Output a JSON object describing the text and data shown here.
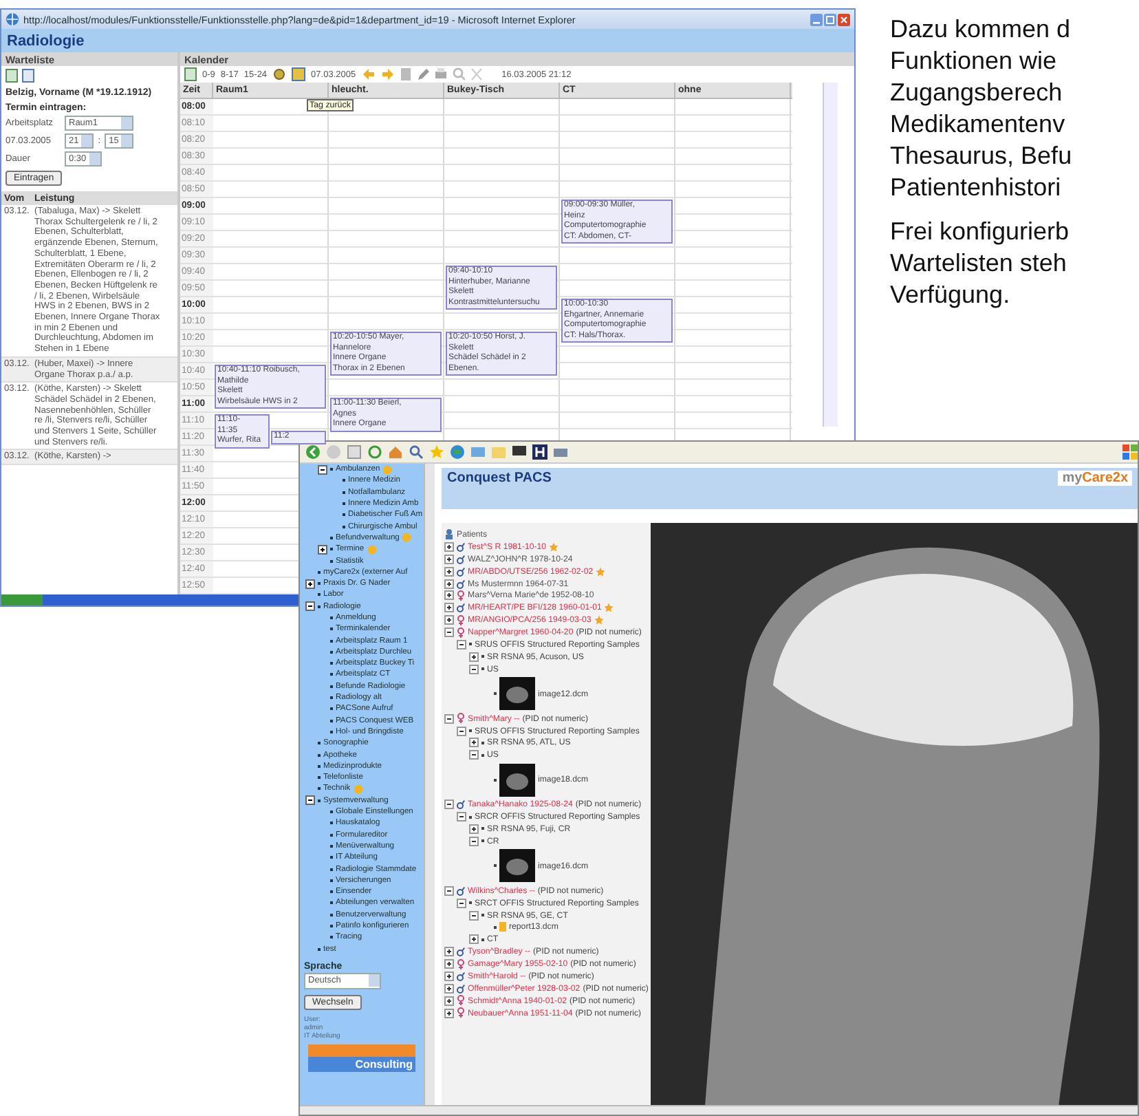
{
  "ie_window": {
    "title": "http://localhost/modules/Funktionsstelle/Funktionsstelle.php?lang=de&pid=1&department_id=19 - Microsoft Internet Explorer",
    "page_title": "Radiologie",
    "waitlist": {
      "title": "Warteliste",
      "patient": "Belzig, Vorname (M *19.12.1912)",
      "form_title": "Termin eintragen:",
      "workplace_label": "Arbeitsplatz",
      "workplace": "Raum1",
      "date": "07.03.2005",
      "hour": "21",
      "separator": ":",
      "minute": "15",
      "duration_label": "Dauer",
      "duration": "0:30",
      "submit": "Eintragen",
      "columns": [
        "Vom",
        "Leistung"
      ],
      "rows": [
        {
          "date": "03.12.",
          "text": "(Tabaluga, Max) -> Skelett Thorax Schultergelenk re / li, 2 Ebenen, Schulterblatt, ergänzende Ebenen, Sternum, Schulterblatt, 1 Ebene, Extremitäten Oberarm re / li, 2 Ebenen, Ellenbogen re / li, 2 Ebenen, Becken Hüftgelenk re / li, 2 Ebenen, Wirbelsäule HWS in 2 Ebenen, BWS in 2 Ebenen, Innere Organe Thorax in min 2 Ebenen und Durchleuchtung, Abdomen im Stehen in 1 Ebene"
        },
        {
          "date": "03.12.",
          "text": "(Huber, Maxei) -> Innere Organe Thorax p.a./ a.p."
        },
        {
          "date": "03.12.",
          "text": "(Köthe, Karsten) -> Skelett Schädel Schädel in 2 Ebenen, Nasennebenhöhlen, Schüller re /li, Stenvers re/li, Schüller und Stenvers 1 Seite, Schüller und Stenvers re/li."
        },
        {
          "date": "03.12.",
          "text": "(Köthe, Karsten) ->"
        }
      ]
    },
    "calendar": {
      "title": "Kalender",
      "ranges": [
        "0-9",
        "8-17",
        "15-24"
      ],
      "date": "07.03.2005",
      "now": "16.03.2005 21:12",
      "tooltip": "Tag zurück",
      "columns": [
        "Zeit",
        "Raum1",
        "hleucht.",
        "Bukey-Tisch",
        "CT",
        "ohne"
      ],
      "times": [
        {
          "label": "08:00",
          "full_hour": true
        },
        {
          "label": "08:10",
          "full_hour": false
        },
        {
          "label": "08:20",
          "full_hour": false
        },
        {
          "label": "08:30",
          "full_hour": false
        },
        {
          "label": "08:40",
          "full_hour": false
        },
        {
          "label": "08:50",
          "full_hour": false
        },
        {
          "label": "09:00",
          "full_hour": true,
          "cells": [
            null,
            null,
            null,
            {
              "kind": "full",
              "lines": [
                "09:00-09:30 Müller,",
                "Heinz",
                "Computertomographie",
                "CT: Abdomen, CT-"
              ]
            },
            null
          ]
        },
        {
          "label": "09:10",
          "full_hour": false
        },
        {
          "label": "09:20",
          "full_hour": false
        },
        {
          "label": "09:30",
          "full_hour": false
        },
        {
          "label": "09:40",
          "full_hour": false,
          "cells": [
            null,
            null,
            {
              "kind": "full",
              "lines": [
                "09:40-10:10",
                "Hinterhuber, Marianne",
                "Skelett",
                "Kontrastmitteluntersuchu"
              ]
            },
            null,
            null
          ]
        },
        {
          "label": "09:50",
          "full_hour": false
        },
        {
          "label": "10:00",
          "full_hour": true,
          "cells": [
            null,
            null,
            null,
            {
              "kind": "full",
              "lines": [
                "10:00-10:30",
                "Ehgartner, Annemarie",
                "Computertomographie",
                "CT: Hals/Thorax."
              ]
            },
            null
          ]
        },
        {
          "label": "10:10",
          "full_hour": false
        },
        {
          "label": "10:20",
          "full_hour": false,
          "cells": [
            null,
            {
              "kind": "full",
              "lines": [
                "10:20-10:50 Mayer,",
                "Hannelore",
                "Innere Organe",
                "Thorax in 2 Ebenen"
              ]
            },
            {
              "kind": "full",
              "lines": [
                "10:20-10:50 Horst, J.",
                "Skelett",
                "Schädel Schädel in 2",
                "Ebenen."
              ]
            },
            null,
            null
          ]
        },
        {
          "label": "10:30",
          "full_hour": false
        },
        {
          "label": "10:40",
          "full_hour": false,
          "cells": [
            {
              "kind": "full",
              "lines": [
                "10:40-11:10 Roibusch,",
                "Mathilde",
                "Skelett",
                "Wirbelsäule HWS in 2"
              ]
            },
            null,
            null,
            null,
            null
          ]
        },
        {
          "label": "10:50",
          "full_hour": false
        },
        {
          "label": "11:00",
          "full_hour": true,
          "cells": [
            null,
            {
              "kind": "full",
              "lines": [
                "11:00-11:30 Beierl,",
                "Agnes",
                "Innere Organe"
              ]
            },
            null,
            null,
            null
          ]
        },
        {
          "label": "11:10",
          "full_hour": false,
          "cells": [
            {
              "kind": "left",
              "lines": [
                "11:10-",
                "11:35",
                "Wurfer, Rita"
              ]
            },
            null,
            null,
            null,
            null
          ]
        },
        {
          "label": "11:20",
          "full_hour": false,
          "cells": [
            {
              "kind": "right",
              "lines": [
                "11:2"
              ]
            },
            null,
            null,
            null,
            null
          ]
        },
        {
          "label": "11:30",
          "full_hour": false
        },
        {
          "label": "11:40",
          "full_hour": false
        },
        {
          "label": "11:50",
          "full_hour": false
        },
        {
          "label": "12:00",
          "full_hour": true
        },
        {
          "label": "12:10",
          "full_hour": false
        },
        {
          "label": "12:20",
          "full_hour": false
        },
        {
          "label": "12:30",
          "full_hour": false
        },
        {
          "label": "12:40",
          "full_hour": false
        },
        {
          "label": "12:50",
          "full_hour": false
        }
      ]
    }
  },
  "slide_text": {
    "paragraphs": [
      [
        "Dazu kommen d",
        "Funktionen wie",
        "Zugangsberech",
        "Medikamentenv",
        "Thesaurus, Befu",
        "Patientenhistori"
      ],
      [
        "Frei konfigurierb",
        "Wartelisten steh",
        "Verfügung."
      ]
    ]
  },
  "pacs_window": {
    "header": "Conquest PACS",
    "logo": {
      "prefix": "my",
      "brand": "Care2x"
    },
    "menu": {
      "continued": [
        {
          "label": "Ambulanzen",
          "badge": true,
          "expanded": true,
          "children": [
            {
              "label": "Innere Medizin"
            },
            {
              "label": "Notfallambulanz"
            },
            {
              "label": "Innere Medizin Amb"
            },
            {
              "label": "Diabetischer Fuß Am"
            },
            {
              "label": "Chirurgische Ambul"
            }
          ]
        },
        {
          "label": "Befundverwaltung",
          "badge": true
        },
        {
          "label": "Termine",
          "badge": true,
          "expanded": false
        },
        {
          "label": "Statistik"
        }
      ],
      "items": [
        {
          "label": "myCare2x (externer Auf"
        },
        {
          "label": "Praxis Dr. G Nader",
          "expanded": false
        },
        {
          "label": "Labor"
        },
        {
          "label": "Radiologie",
          "expanded": true,
          "children": [
            {
              "label": "Anmeldung"
            },
            {
              "label": "Terminkalender"
            },
            {
              "label": "Arbeitsplatz Raum 1"
            },
            {
              "label": "Arbeitsplatz Durchleu"
            },
            {
              "label": "Arbeitsplatz Buckey Ti"
            },
            {
              "label": "Arbeitsplatz CT"
            },
            {
              "label": "Befunde Radiologie"
            },
            {
              "label": "Radiology alt"
            },
            {
              "label": "PACSone Aufruf"
            },
            {
              "label": "PACS Conquest WEB"
            },
            {
              "label": "Hol- und Bringdiste"
            }
          ]
        },
        {
          "label": "Sonographie"
        },
        {
          "label": "Apotheke"
        },
        {
          "label": "Medizinprodukte"
        },
        {
          "label": "Telefonliste"
        },
        {
          "label": "Technik",
          "badge": true
        },
        {
          "label": "Systemverwaltung",
          "expanded": true,
          "children": [
            {
              "label": "Globale Einstellungen"
            },
            {
              "label": "Hauskatalog"
            },
            {
              "label": "Formulareditor"
            },
            {
              "label": "Menüverwaltung"
            },
            {
              "label": "IT Abteilung"
            },
            {
              "label": "Radiologie Stammdate"
            },
            {
              "label": "Versicherungen"
            },
            {
              "label": "Einsender"
            },
            {
              "label": "Abteilungen verwalten"
            },
            {
              "label": "Benutzerverwaltung"
            },
            {
              "label": "Patinfo konfigurieren"
            },
            {
              "label": "Tracing"
            }
          ]
        },
        {
          "label": "test"
        }
      ]
    },
    "language_label": "Sprache",
    "language": "Deutsch",
    "switch_button": "Wechseln",
    "user_info": [
      "User:",
      "admin",
      "IT Abteilung"
    ],
    "company_logo": "Consulting",
    "tree": {
      "root": "Patients",
      "patients": [
        {
          "name": "Test^S R 1981-10-10",
          "female": false,
          "highlighted": true,
          "starred": true,
          "expanded": false
        },
        {
          "name": "WALZ^JOHN^R 1978-10-24",
          "female": false,
          "highlighted": false,
          "starred": false,
          "expanded": false
        },
        {
          "name": "MR/ABDO/UTSE/256 1962-02-02",
          "female": false,
          "highlighted": true,
          "starred": true,
          "expanded": false
        },
        {
          "name": "Ms Mustermnn 1964-07-31",
          "female": false,
          "highlighted": false,
          "starred": false,
          "expanded": false
        },
        {
          "name": "Mars^Verna Marie^de 1952-08-10",
          "female": true,
          "highlighted": false,
          "starred": false,
          "expanded": false
        },
        {
          "name": "MR/HEART/PE BFI/128 1960-01-01",
          "female": false,
          "highlighted": true,
          "starred": true,
          "expanded": false
        },
        {
          "name": "MR/ANGIO/PCA/256 1949-03-03",
          "female": true,
          "highlighted": true,
          "starred": true,
          "expanded": false
        },
        {
          "name": "Napper^Margret 1960-04-20",
          "note": "(PID not numeric)",
          "female": true,
          "highlighted": true,
          "starred": false,
          "expanded": true,
          "children": [
            {
              "kind": "study",
              "label": "SRUS OFFIS Structured Reporting Samples",
              "expanded": true,
              "children": [
                {
                  "kind": "series",
                  "label": "SR RSNA 95, Acuson, US",
                  "expanded": false
                },
                {
                  "kind": "series",
                  "label": "US",
                  "expanded": true,
                  "children": [
                    {
                      "kind": "image",
                      "label": "image12.dcm"
                    }
                  ]
                }
              ]
            }
          ]
        },
        {
          "name": "Smith^Mary --",
          "note": "(PID not numeric)",
          "female": true,
          "highlighted": true,
          "starred": false,
          "expanded": true,
          "children": [
            {
              "kind": "study",
              "label": "SRUS OFFIS Structured Reporting Samples",
              "expanded": true,
              "children": [
                {
                  "kind": "series",
                  "label": "SR RSNA 95, ATL, US",
                  "expanded": false
                },
                {
                  "kind": "series",
                  "label": "US",
                  "expanded": true,
                  "children": [
                    {
                      "kind": "image",
                      "label": "image18.dcm"
                    }
                  ]
                }
              ]
            }
          ]
        },
        {
          "name": "Tanaka^Hanako 1925-08-24",
          "note": "(PID not numeric)",
          "female": false,
          "highlighted": true,
          "starred": false,
          "expanded": true,
          "children": [
            {
              "kind": "study",
              "label": "SRCR OFFIS Structured Reporting Samples",
              "expanded": true,
              "children": [
                {
                  "kind": "series",
                  "label": "SR RSNA 95, Fuji, CR",
                  "expanded": false
                },
                {
                  "kind": "series",
                  "label": "CR",
                  "expanded": true,
                  "children": [
                    {
                      "kind": "image",
                      "label": "image16.dcm"
                    }
                  ]
                }
              ]
            }
          ]
        },
        {
          "name": "Wilkins^Charles --",
          "note": "(PID not numeric)",
          "female": false,
          "highlighted": true,
          "starred": false,
          "expanded": true,
          "children": [
            {
              "kind": "study",
              "label": "SRCT OFFIS Structured Reporting Samples",
              "expanded": true,
              "children": [
                {
                  "kind": "series",
                  "label": "SR RSNA 95, GE, CT",
                  "expanded": true,
                  "children": [
                    {
                      "kind": "report",
                      "label": "report13.dcm"
                    }
                  ]
                },
                {
                  "kind": "series",
                  "label": "CT",
                  "expanded": false
                }
              ]
            }
          ]
        },
        {
          "name": "Tyson^Bradley --",
          "note": "(PID not numeric)",
          "female": false,
          "highlighted": true,
          "starred": false,
          "expanded": false
        },
        {
          "name": "Gamage^Mary 1955-02-10",
          "note": "(PID not numeric)",
          "female": true,
          "highlighted": true,
          "starred": false,
          "expanded": false
        },
        {
          "name": "Smith^Harold --",
          "note": "(PID not numeric)",
          "female": false,
          "highlighted": true,
          "starred": false,
          "expanded": false
        },
        {
          "name": "Offenmüller^Peter 1928-03-02",
          "note": "(PID not numeric)",
          "female": false,
          "highlighted": true,
          "starred": false,
          "expanded": false
        },
        {
          "name": "Schmidt^Anna 1940-01-02",
          "note": "(PID not numeric)",
          "female": true,
          "highlighted": true,
          "starred": false,
          "expanded": false
        },
        {
          "name": "Neubauer^Anna 1951-11-04",
          "note": "(PID not numeric)",
          "female": true,
          "highlighted": true,
          "starred": false,
          "expanded": false
        }
      ]
    }
  }
}
